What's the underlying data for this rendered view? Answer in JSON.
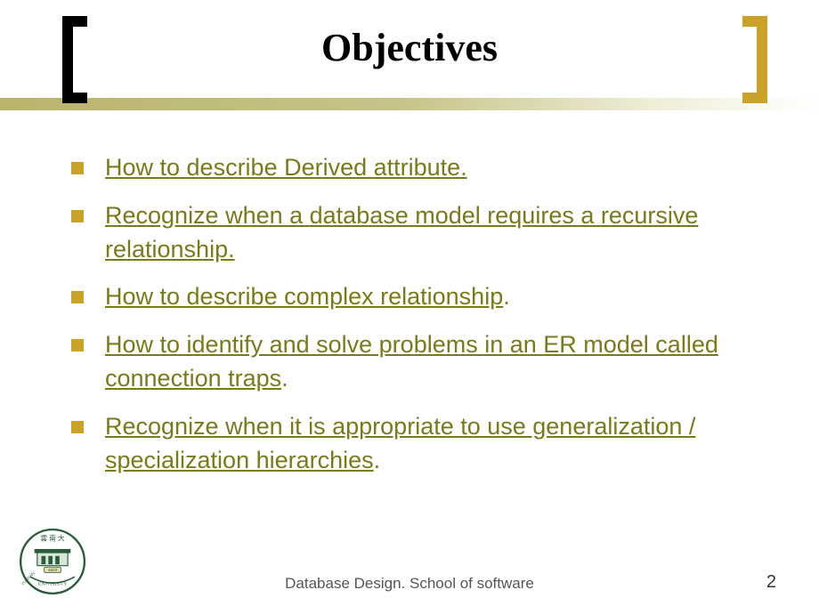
{
  "title": "Objectives",
  "objectives": [
    {
      "text": "How to describe Derived attribute.",
      "trailing": ""
    },
    {
      "text": "Recognize when a database model requires a recursive relationship.",
      "trailing": ""
    },
    {
      "text": "How to describe complex relationship",
      "trailing": "."
    },
    {
      "text": "How to identify and solve problems in an ER model called connection traps",
      "trailing": "."
    },
    {
      "text": "Recognize when it is appropriate to use generalization / specialization hierarchies",
      "trailing": "."
    }
  ],
  "footer": "Database Design.  School of software",
  "page": "2"
}
